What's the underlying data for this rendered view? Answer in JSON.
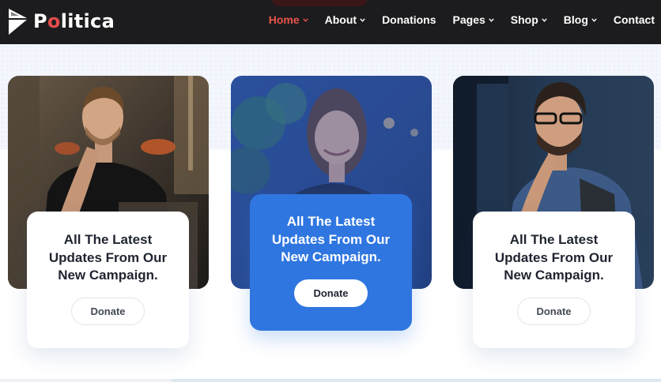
{
  "brand": {
    "name_part1": "P",
    "name_accent": "o",
    "name_part2": "litica"
  },
  "nav": {
    "items": [
      {
        "label": "Home",
        "dropdown": true,
        "active": true
      },
      {
        "label": "About",
        "dropdown": true
      },
      {
        "label": "Donations",
        "dropdown": false
      },
      {
        "label": "Pages",
        "dropdown": true
      },
      {
        "label": "Shop",
        "dropdown": true
      },
      {
        "label": "Blog",
        "dropdown": true
      },
      {
        "label": "Contact",
        "dropdown": false
      }
    ]
  },
  "cards": [
    {
      "title": "All The Latest Updates From Our New Campaign.",
      "button": "Donate",
      "style": "white"
    },
    {
      "title": "All The Latest Updates From Our New Campaign.",
      "button": "Donate",
      "style": "blue"
    },
    {
      "title": "All The Latest Updates From Our New Campaign.",
      "button": "Donate",
      "style": "white"
    }
  ],
  "colors": {
    "header_bg": "#1c1c1e",
    "nav_active": "#e8554b",
    "brand_accent": "#e24b4b",
    "card_highlight": "#2f76e0",
    "band_bg": "#f3f6fc"
  },
  "icons": {
    "logo": "politica-logo-icon",
    "dropdown": "chevron-down-icon"
  }
}
